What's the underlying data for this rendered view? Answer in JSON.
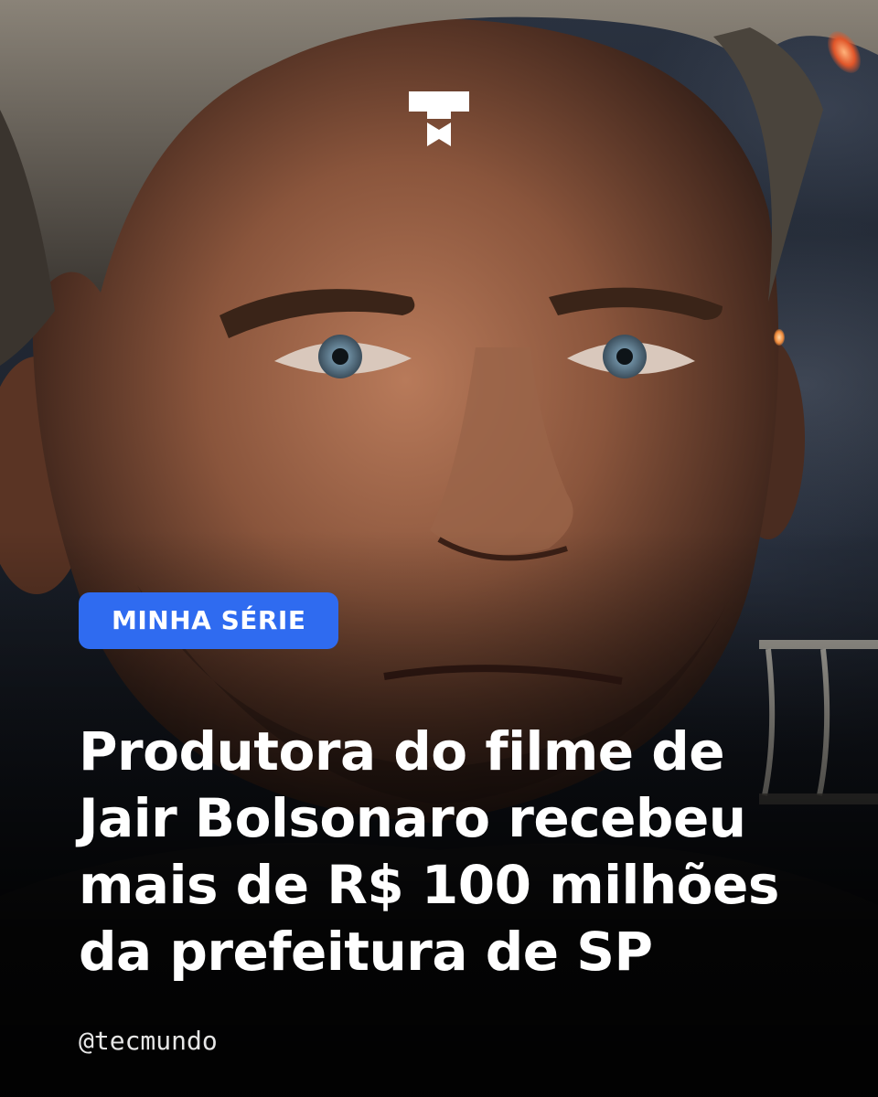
{
  "post": {
    "category": "MINHA SÉRIE",
    "headline": "Produtora do filme de Jair Bolsonaro recebeu mais de R$ 100 milhões da prefeitura de SP",
    "handle": "@tecmundo"
  },
  "colors": {
    "badge": "#2f6bf0",
    "text": "#ffffff"
  },
  "icons": {
    "logo": "tecmundo-logo-icon"
  }
}
